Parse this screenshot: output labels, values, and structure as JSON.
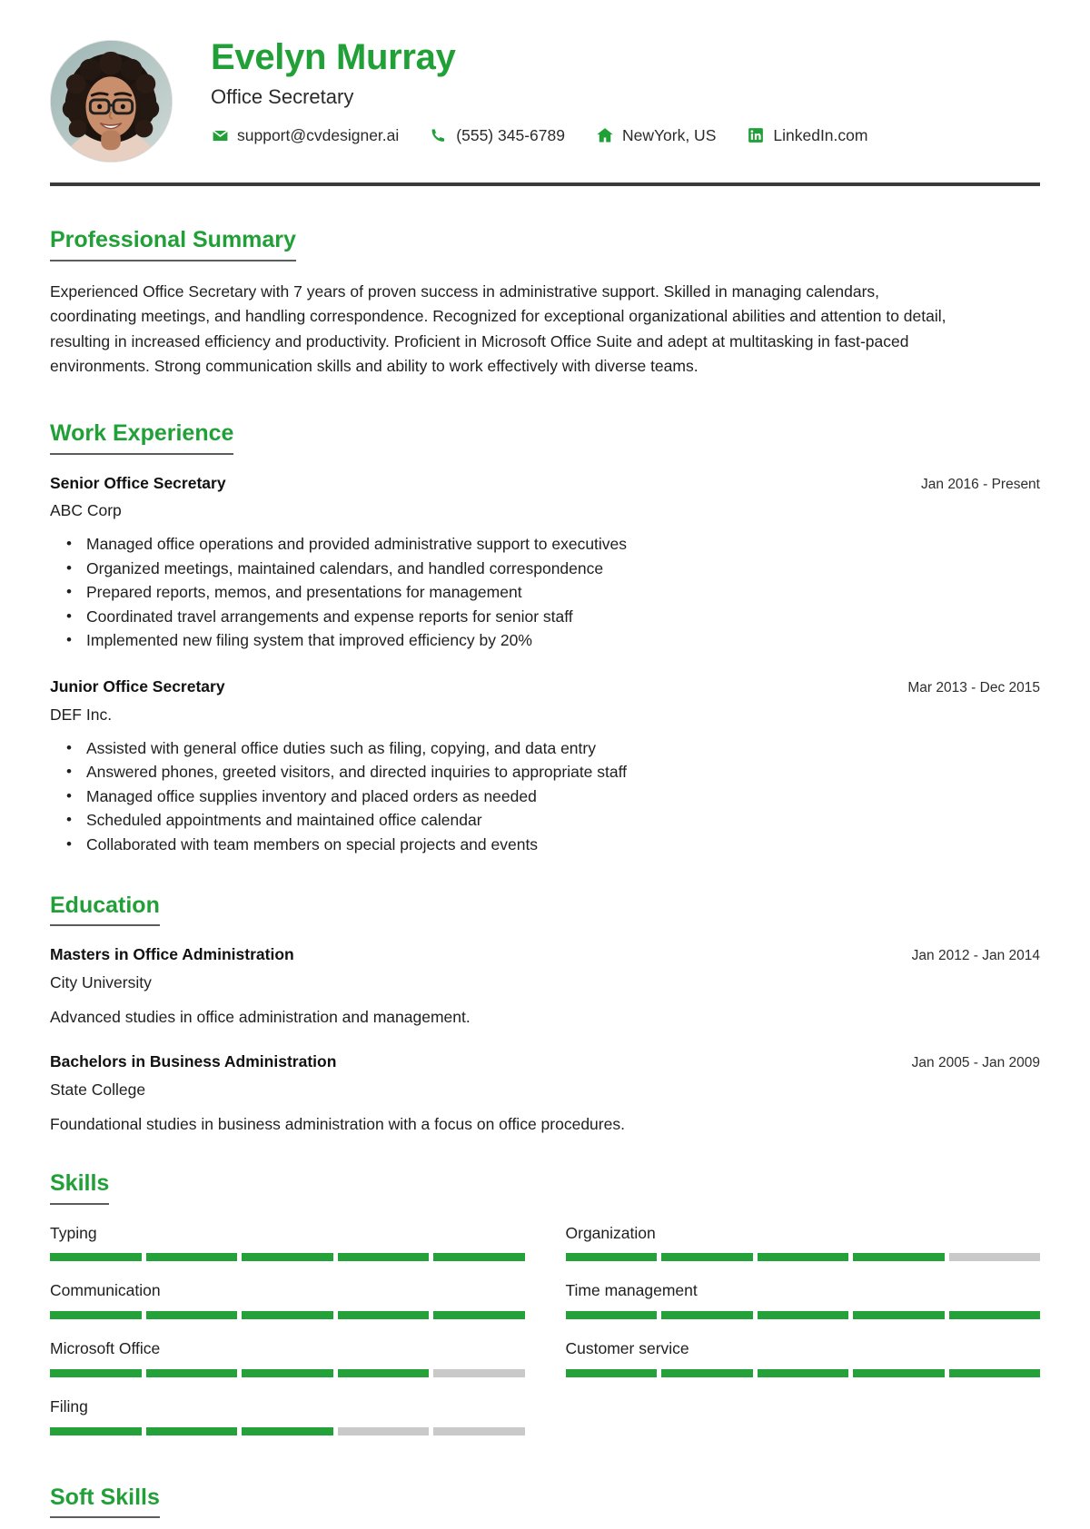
{
  "profile": {
    "name": "Evelyn Murray",
    "title": "Office Secretary",
    "avatar_alt": "profile-photo"
  },
  "contacts": [
    {
      "icon": "envelope-icon",
      "label": "support@cvdesigner.ai"
    },
    {
      "icon": "phone-icon",
      "label": "(555) 345-6789"
    },
    {
      "icon": "home-icon",
      "label": "NewYork, US"
    },
    {
      "icon": "linkedin-icon",
      "label": "LinkedIn.com"
    }
  ],
  "colors": {
    "accent_green": "#21a038",
    "bar_green": "#25a13a",
    "bar_gray": "#c9c9c9",
    "rule_dark": "#3a3a3a",
    "underline_gray": "#5c5c5c"
  },
  "sections": {
    "summary": {
      "heading": "Professional Summary",
      "text": "Experienced Office Secretary with 7 years of proven success in administrative support. Skilled in managing calendars, coordinating meetings, and handling correspondence. Recognized for exceptional organizational abilities and attention to detail, resulting in increased efficiency and productivity. Proficient in Microsoft Office Suite and adept at multitasking in fast-paced environments. Strong communication skills and ability to work effectively with diverse teams."
    },
    "work": {
      "heading": "Work Experience",
      "entries": [
        {
          "role": "Senior Office Secretary",
          "date": "Jan 2016 - Present",
          "org": "ABC Corp",
          "bullets": [
            "Managed office operations and provided administrative support to executives",
            "Organized meetings, maintained calendars, and handled correspondence",
            "Prepared reports, memos, and presentations for management",
            "Coordinated travel arrangements and expense reports for senior staff",
            "Implemented new filing system that improved efficiency by 20%"
          ]
        },
        {
          "role": "Junior Office Secretary",
          "date": "Mar 2013 - Dec 2015",
          "org": "DEF Inc.",
          "bullets": [
            "Assisted with general office duties such as filing, copying, and data entry",
            "Answered phones, greeted visitors, and directed inquiries to appropriate staff",
            "Managed office supplies inventory and placed orders as needed",
            "Scheduled appointments and maintained office calendar",
            "Collaborated with team members on special projects and events"
          ]
        }
      ]
    },
    "education": {
      "heading": "Education",
      "entries": [
        {
          "degree": "Masters in Office Administration",
          "date": "Jan 2012 - Jan 2014",
          "school": "City University",
          "description": "Advanced studies in office administration and management."
        },
        {
          "degree": "Bachelors in Business Administration",
          "date": "Jan 2005 - Jan 2009",
          "school": "State College",
          "description": "Foundational studies in business administration with a focus on office procedures."
        }
      ]
    },
    "skills": {
      "heading": "Skills",
      "segments_total": 5,
      "items": [
        {
          "name": "Typing",
          "filled": 5
        },
        {
          "name": "Organization",
          "filled": 4
        },
        {
          "name": "Communication",
          "filled": 5
        },
        {
          "name": "Time management",
          "filled": 5
        },
        {
          "name": "Microsoft Office",
          "filled": 4
        },
        {
          "name": "Customer service",
          "filled": 5
        },
        {
          "name": "Filing",
          "filled": 3
        }
      ]
    },
    "soft_skills": {
      "heading": "Soft Skills"
    }
  }
}
